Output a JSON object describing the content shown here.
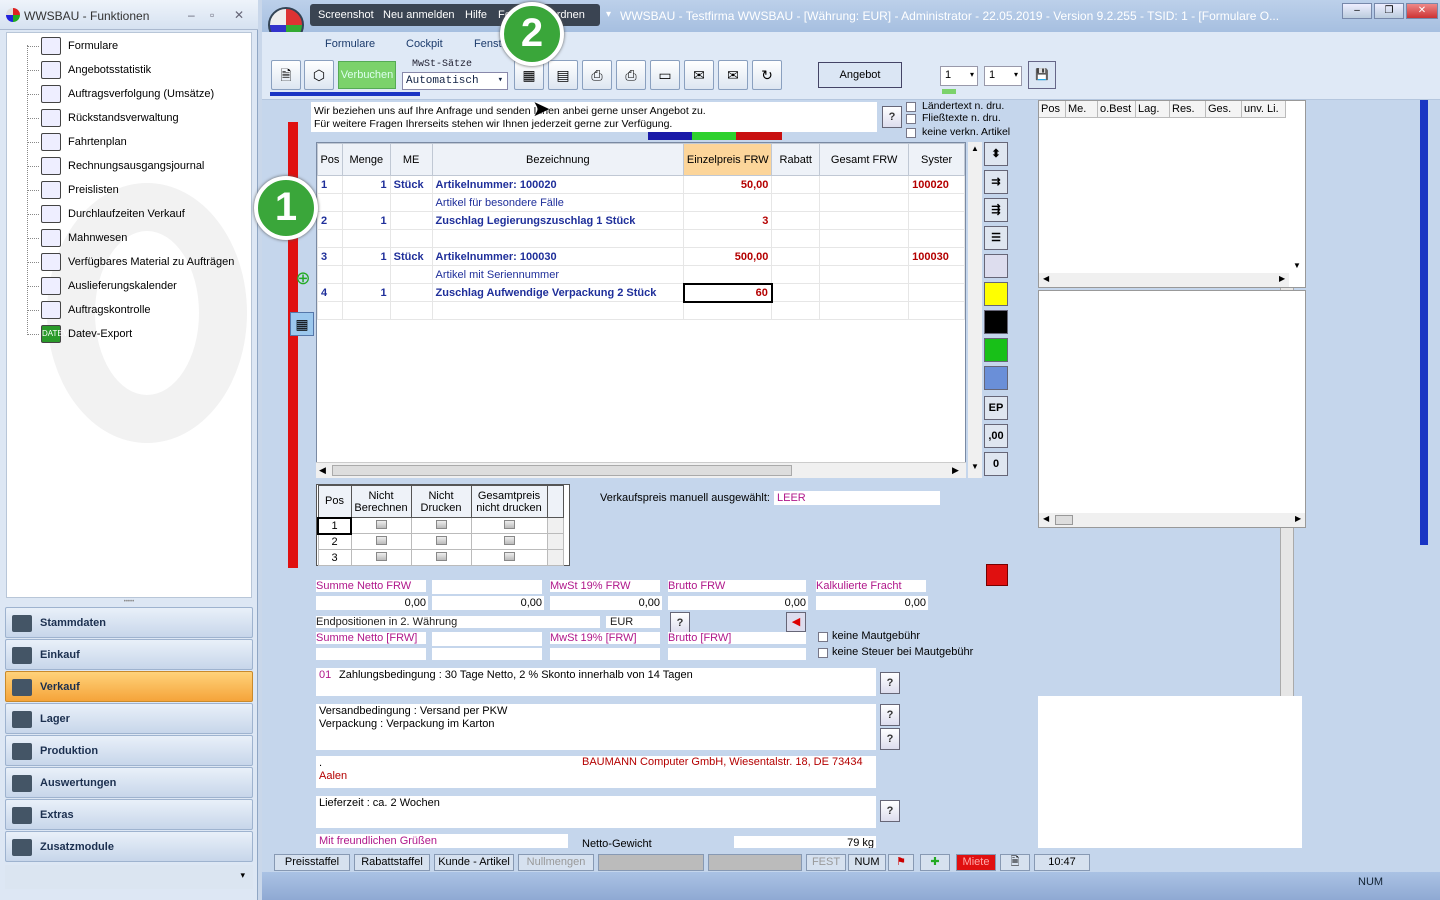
{
  "left_panel": {
    "title": "WWSBAU - Funktionen",
    "tree": [
      {
        "label": "Formulare",
        "icon": "document-icon"
      },
      {
        "label": "Angebotsstatistik",
        "icon": "statistics-icon"
      },
      {
        "label": "Auftragsverfolgung (Umsätze)",
        "icon": "tracking-icon"
      },
      {
        "label": "Rückstandsverwaltung",
        "icon": "backlog-icon"
      },
      {
        "label": "Fahrtenplan",
        "icon": "truck-icon"
      },
      {
        "label": "Rechnungsausgangsjournal",
        "icon": "journal-icon"
      },
      {
        "label": "Preislisten",
        "icon": "price-tag-icon"
      },
      {
        "label": "Durchlaufzeiten Verkauf",
        "icon": "hourglass-icon"
      },
      {
        "label": "Mahnwesen",
        "icon": "dunning-icon"
      },
      {
        "label": "Verfügbares Material zu Aufträgen",
        "icon": "material-icon"
      },
      {
        "label": "Auslieferungskalender",
        "icon": "calendar-icon"
      },
      {
        "label": "Auftragskontrolle",
        "icon": "checklist-icon"
      },
      {
        "label": "Datev-Export",
        "icon": "datev-icon",
        "icon_text": "DATEV"
      }
    ],
    "nav": [
      {
        "label": "Stammdaten"
      },
      {
        "label": "Einkauf"
      },
      {
        "label": "Verkauf",
        "selected": true
      },
      {
        "label": "Lager"
      },
      {
        "label": "Produktion"
      },
      {
        "label": "Auswertungen"
      },
      {
        "label": "Extras"
      },
      {
        "label": "Zusatzmodule"
      }
    ]
  },
  "window": {
    "quick_menu": [
      "Screenshot",
      "Neu anmelden",
      "Hilfe",
      "Fenster anordnen"
    ],
    "title": "WWSBAU - Testfirma WWSBAU - [Währung: EUR] - Administrator - 22.05.2019 - Version 9.2.255 - TSID: 1 - [Formulare O...",
    "ribbon_tabs": [
      "Formulare",
      "Cockpit",
      "Fenst"
    ],
    "toolbar": {
      "verbuchen": "Verbuchen",
      "mwst_label": "MwSt-Sätze",
      "mwst_value": "Automatisch",
      "angebot": "Angebot",
      "spin1": "1",
      "spin2": "1"
    }
  },
  "badges": {
    "one": "1",
    "two": "2"
  },
  "intro_text": [
    "Wir beziehen uns auf Ihre Anfrage und senden Ihnen anbei gerne unser Angebot zu.",
    "Für weitere Fragen Ihrerseits stehen wir Ihnen jederzeit gerne zur Verfügung."
  ],
  "print_options": [
    "Ländertext n. dru.",
    "Fließtexte n. dru.",
    "keine verkn. Artikel"
  ],
  "colors": {
    "accent_red": "#e01010",
    "blue_bar": "#1a35c4",
    "highlight_col": "#fcd59a",
    "item_blue": "#1f2f9a",
    "value_red": "#b40000",
    "label_magenta": "#b0178a"
  },
  "grid": {
    "columns": [
      "Pos",
      "Menge",
      "ME",
      "Bezeichnung",
      "Einzelpreis FRW",
      "Rabatt",
      "Gesamt FRW",
      "Syster"
    ],
    "rows": [
      [
        "1",
        "1",
        "Stück",
        "Artikelnummer: 100020",
        "50,00",
        "",
        "",
        "100020"
      ],
      [
        "",
        "",
        "",
        "Artikel für besondere Fälle",
        "",
        "",
        "",
        ""
      ],
      [
        "2",
        "1",
        "",
        "Zuschlag Legierungszuschlag 1 Stück",
        "3",
        "",
        "",
        ""
      ],
      [
        "",
        "",
        "",
        "",
        "",
        "",
        "",
        ""
      ],
      [
        "3",
        "1",
        "Stück",
        "Artikelnummer: 100030",
        "500,00",
        "",
        "",
        "100030"
      ],
      [
        "",
        "",
        "",
        "Artikel mit Seriennummer",
        "",
        "",
        "",
        ""
      ],
      [
        "4",
        "1",
        "",
        "Zuschlag Aufwendige Verpackung 2 Stück",
        "60",
        "",
        "",
        ""
      ],
      [
        "",
        "",
        "",
        "",
        "",
        "",
        "",
        ""
      ]
    ]
  },
  "side_tools": [
    "EP",
    ",00",
    "0"
  ],
  "pos_grid": {
    "columns": [
      "Pos",
      "Nicht Berechnen",
      "Nicht Drucken",
      "Gesamtpreis nicht drucken"
    ],
    "rows": [
      "1",
      "2",
      "3"
    ]
  },
  "vk_label": "Verkaufspreis manuell ausgewählt:",
  "vk_value": "LEER",
  "sums": {
    "netto_label": "Summe Netto FRW",
    "netto": "0,00",
    "second": "0,00",
    "mwst_label": "MwSt 19% FRW",
    "mwst": "0,00",
    "brutto_label": "Brutto FRW",
    "brutto": "0,00",
    "fracht_label": "Kalkulierte Fracht",
    "fracht": "0,00",
    "end2_label": "Endpositionen in 2. Währung",
    "currency": "EUR",
    "netto2_label": "Summe Netto [FRW]",
    "mwst2_label": "MwSt 19% [FRW]",
    "brutto2_label": "Brutto [FRW]",
    "maut1": "keine Mautgebühr",
    "maut2": "keine Steuer bei Mautgebühr"
  },
  "texts": {
    "zahl_code": "01",
    "zahl": "Zahlungsbedingung : 30 Tage Netto, 2 % Skonto innerhalb von 14 Tagen",
    "versand": "Versandbedingung : Versand per PKW",
    "verpackung": "Verpackung :  Verpackung im Karton",
    "address": "BAUMANN Computer GmbH, Wiesentalstr. 18, DE 73434",
    "address_dot": ".",
    "city": "Aalen",
    "liefer": "Lieferzeit : ca. 2 Wochen",
    "gruss": "Mit freundlichen Grüßen",
    "gewicht_label": "Netto-Gewicht",
    "gewicht": "79 kg"
  },
  "right_grid_cols": [
    "Pos",
    "Me.",
    "o.Best",
    "Lag.",
    "Res.",
    "Ges.",
    "unv. Li."
  ],
  "status": {
    "items": [
      "Preisstaffel",
      "Rabattstaffel",
      "Kunde - Artikel",
      "Nullmengen",
      "",
      "",
      "FEST",
      "NUM",
      "",
      "",
      "Miete",
      "",
      "10:47"
    ]
  },
  "bottom_status": "NUM"
}
